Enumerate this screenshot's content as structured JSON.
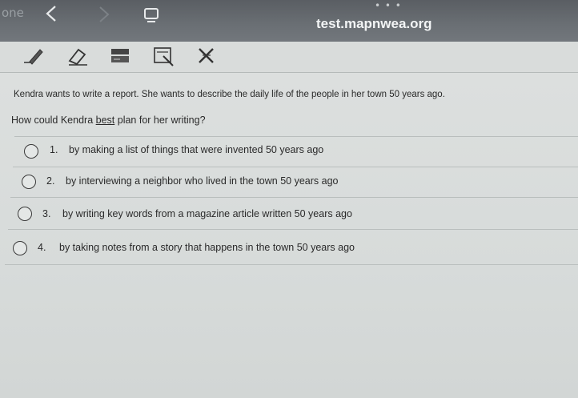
{
  "browser": {
    "tab_label": "one",
    "url": "test.mapnwea.org",
    "dots": "• • •"
  },
  "toolbar": {
    "tools": [
      {
        "icon": "pencil-icon"
      },
      {
        "icon": "eraser-icon"
      },
      {
        "icon": "highlighter-icon"
      },
      {
        "icon": "line-reader-icon"
      },
      {
        "icon": "answer-eliminator-icon"
      }
    ]
  },
  "question": {
    "passage": "Kendra wants to write a report. She wants to describe the daily life of the people in her town 50 years ago.",
    "prompt_before": "How could Kendra ",
    "prompt_emphasis": "best",
    "prompt_after": " plan for her writing?",
    "choices": [
      {
        "number": "1.",
        "text": "by making a list of things that were invented 50 years ago"
      },
      {
        "number": "2.",
        "text": "by interviewing a neighbor who lived in the town 50 years ago"
      },
      {
        "number": "3.",
        "text": "by writing key words from a magazine article written 50 years ago"
      },
      {
        "number": "4.",
        "text": "by taking notes from a story that happens in the town 50 years ago"
      }
    ]
  },
  "colors": {
    "browser_bar": "#62676c",
    "page_background": "#d8dbda",
    "text": "#2a2a2a"
  }
}
